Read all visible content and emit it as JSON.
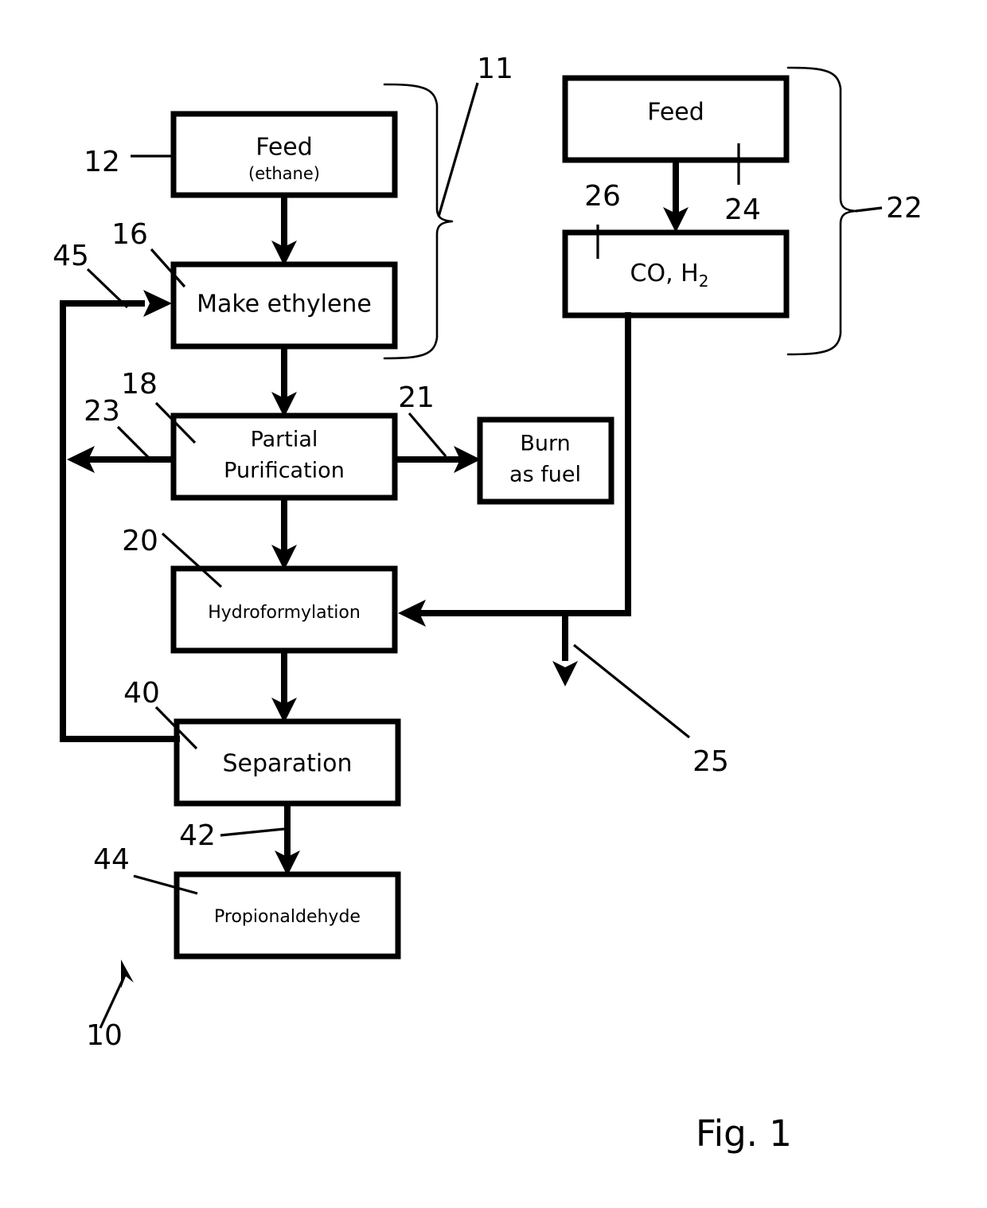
{
  "figure": {
    "caption": "Fig. 1",
    "overall_ref": "10"
  },
  "boxes": {
    "feed_ethane": {
      "title": "Feed",
      "subtitle": "(ethane)",
      "ref": "12"
    },
    "make_ethylene": {
      "title": "Make ethylene",
      "ref": "16"
    },
    "partial_purification": {
      "title_line1": "Partial",
      "title_line2": "Purification",
      "ref": "18"
    },
    "hydroformylation": {
      "title": "Hydroformylation",
      "ref": "20"
    },
    "separation": {
      "title": "Separation",
      "ref": "40"
    },
    "propionaldehyde": {
      "title": "Propionaldehyde",
      "ref": "44"
    },
    "burn_as_fuel": {
      "title_line1": "Burn",
      "title_line2": "as fuel",
      "ref": "21"
    },
    "feed_syngas": {
      "title": "Feed",
      "ref": "24"
    },
    "co_h2": {
      "title_main": "CO, H",
      "title_sub": "2",
      "ref": "26"
    }
  },
  "streams": {
    "purge_vent": "23",
    "recycle": "45",
    "syngas_purge": "25",
    "product_stream": "42"
  },
  "braces": {
    "ethylene_section": "11",
    "syngas_section": "22"
  },
  "colors": {
    "line": "#000000",
    "background": "#ffffff",
    "box_fill": "#ffffff"
  }
}
